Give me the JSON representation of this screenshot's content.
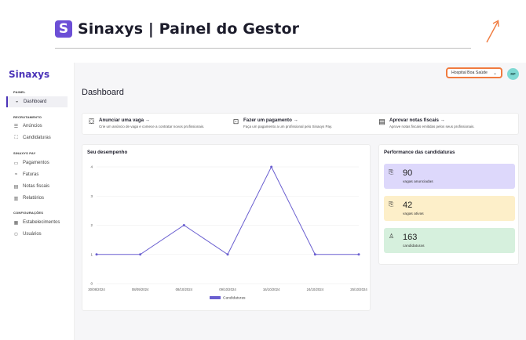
{
  "slide": {
    "logo_letter": "S",
    "title": "Sinaxys | Painel do Gestor"
  },
  "sidebar": {
    "brand": "Sinaxys",
    "sections": [
      {
        "label": "PAINEL",
        "items": [
          {
            "label": "Dashboard",
            "icon": "dashboard-icon",
            "active": true
          }
        ]
      },
      {
        "label": "RECRUTAMENTO",
        "items": [
          {
            "label": "Anúncios",
            "icon": "list-icon"
          },
          {
            "label": "Candidaturas",
            "icon": "user-card-icon"
          }
        ]
      },
      {
        "label": "SINAXYS PAY",
        "items": [
          {
            "label": "Pagamentos",
            "icon": "payment-icon"
          },
          {
            "label": "Faturas",
            "icon": "invoice-icon"
          },
          {
            "label": "Notas fiscais",
            "icon": "receipt-icon"
          },
          {
            "label": "Relatórios",
            "icon": "report-icon"
          }
        ]
      },
      {
        "label": "CONFIGURAÇÕES",
        "items": [
          {
            "label": "Estabelecimentos",
            "icon": "building-icon"
          },
          {
            "label": "Usuários",
            "icon": "users-icon"
          }
        ]
      }
    ]
  },
  "topbar": {
    "establishment": "Hospital Boa Saúde",
    "avatar_initials": "RP",
    "highlight_color": "#f07b3f"
  },
  "page_title": "Dashboard",
  "actions": [
    {
      "title": "Anunciar uma vaga →",
      "desc": "Crie um anúncio de vaga e comece a contratar novos profissionais.",
      "icon": "person-board-icon"
    },
    {
      "title": "Fazer um pagamento →",
      "desc": "Faça um pagamento a um profissional pelo Sinaxys Pay.",
      "icon": "cash-icon"
    },
    {
      "title": "Aprovar notas fiscais →",
      "desc": "Aprove notas fiscais emitidas pelos seus profissionais.",
      "icon": "document-list-icon"
    }
  ],
  "performance": {
    "title": "Seu desempenho"
  },
  "chart_data": {
    "type": "line",
    "x": [
      "30/08/2024",
      "08/09/2024",
      "08/10/2024",
      "09/10/2024",
      "16/10/2024",
      "24/10/2024",
      "25/10/2024"
    ],
    "series": [
      {
        "name": "Candidaturas",
        "values": [
          1,
          1,
          2,
          1,
          4,
          1,
          1
        ],
        "color": "#6a5fd0"
      }
    ],
    "y_ticks": [
      "0",
      "1",
      "2",
      "3",
      "4"
    ],
    "ylim": [
      0,
      4
    ],
    "grid": "horizontal",
    "legend": "bottom"
  },
  "candidaturas": {
    "title": "Performance das candidaturas",
    "stats": [
      {
        "value": "90",
        "label": "vagas anunciadas",
        "color": "#ddd8fb",
        "icon": "clipboard-icon"
      },
      {
        "value": "42",
        "label": "vagas ativas",
        "color": "#fdefc9",
        "icon": "clipboard-check-icon"
      },
      {
        "value": "163",
        "label": "candidaturas",
        "color": "#d6f0dd",
        "icon": "user-check-icon"
      }
    ]
  }
}
